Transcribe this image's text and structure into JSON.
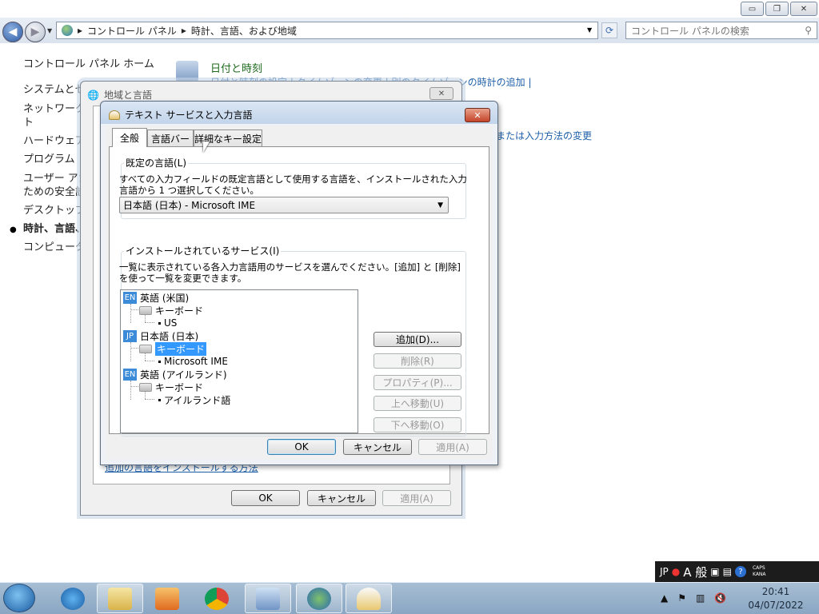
{
  "explorer": {
    "window_controls": {
      "minimize": "▭",
      "maximize": "❐",
      "close": "✕"
    },
    "breadcrumb": [
      "コントロール パネル",
      "時計、言語、および地域"
    ],
    "breadcrumb_sep": "▸",
    "search_placeholder": "コントロール パネルの検索",
    "left_nav": [
      "コントロール パネル ホーム",
      "システムとセ",
      "ネットワーク",
      "ト",
      "ハードウェア",
      "プログラム",
      "ユーザー アカ",
      "ための安全設",
      "デスクトップ",
      "時計、言語、",
      "コンピュータ"
    ],
    "right": {
      "title": "日付と時刻",
      "links": "日付と時刻の設定 | タイムゾーンの変更 | 別のタイムゾーンの時計の追加 |",
      "keyboard_link": "または入力方法の変更"
    }
  },
  "region_dialog": {
    "title": "地域と言語",
    "install_link": "追加の言語をインストールする方法",
    "ok": "OK",
    "cancel": "キャンセル",
    "apply": "適用(A)"
  },
  "text_services_dialog": {
    "title": "テキスト サービスと入力言語",
    "tabs": [
      "全般",
      "言語バー",
      "詳細なキー設定"
    ],
    "default_lang_group": "既定の言語(L)",
    "default_lang_desc": "すべての入力フィールドの既定言語として使用する言語を、インストールされた入力言語から 1 つ選択してください。",
    "default_lang_value": "日本語 (日本) - Microsoft IME",
    "installed_group": "インストールされているサービス(I)",
    "installed_desc": "一覧に表示されている各入力言語用のサービスを選んでください。[追加] と [削除] を使って一覧を変更できます。",
    "tree": {
      "en_us": {
        "badge": "EN",
        "label": "英語 (米国)",
        "keyboard": "キーボード",
        "item": "US"
      },
      "ja_jp": {
        "badge": "JP",
        "label": "日本語 (日本)",
        "keyboard": "キーボード",
        "item": "Microsoft IME"
      },
      "en_ie": {
        "badge": "EN",
        "label": "英語 (アイルランド)",
        "keyboard": "キーボード",
        "item": "アイルランド語"
      }
    },
    "buttons": {
      "add": "追加(D)...",
      "remove": "削除(R)",
      "properties": "プロパティ(P)...",
      "move_up": "上へ移動(U)",
      "move_down": "下へ移動(O)"
    },
    "ok": "OK",
    "cancel": "キャンセル",
    "apply": "適用(A)"
  },
  "taskbar": {
    "lang_bar": {
      "lang": "JP",
      "mode": "A 般",
      "caps": "CAPS",
      "kana": "KANA"
    },
    "time": "20:41",
    "date": "04/07/2022",
    "icons": [
      "ie-icon",
      "explorer-icon",
      "media-player-icon",
      "chrome-icon",
      "control-panel-icon",
      "region-icon",
      "text-services-icon"
    ]
  }
}
